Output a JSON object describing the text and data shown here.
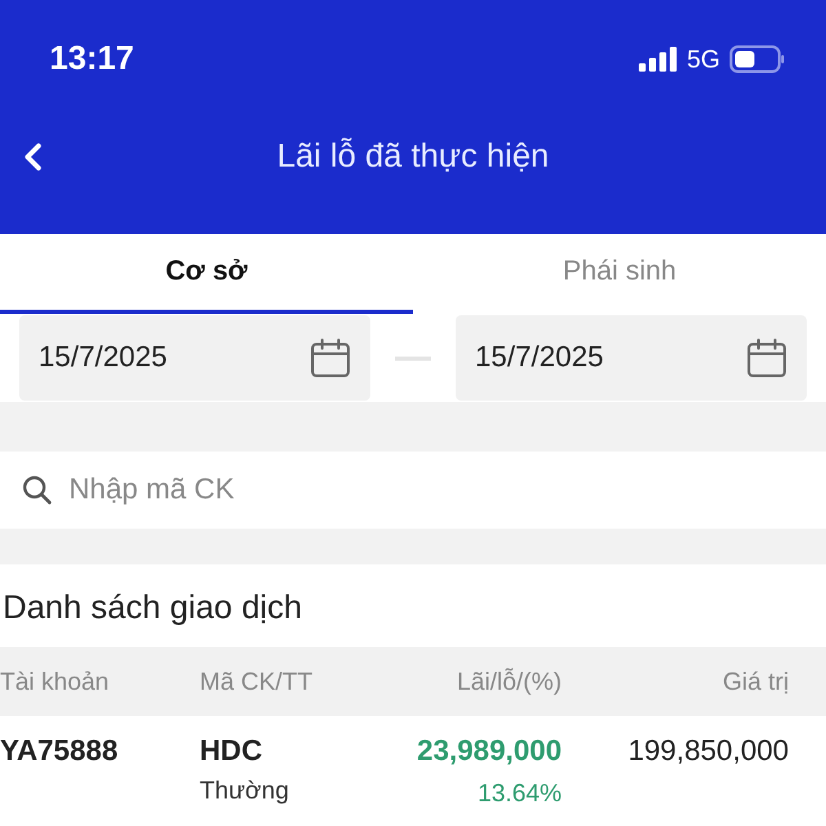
{
  "status_bar": {
    "time": "13:17",
    "network": "5G"
  },
  "header": {
    "title": "Lãi lỗ đã thực hiện"
  },
  "tabs": [
    {
      "label": "Cơ sở",
      "selected": true
    },
    {
      "label": "Phái sinh",
      "selected": false
    }
  ],
  "date_range": {
    "from": "15/7/2025",
    "to": "15/7/2025"
  },
  "search": {
    "placeholder": "Nhập mã CK"
  },
  "list": {
    "title": "Danh sách giao dịch",
    "columns": [
      "Tài khoản",
      "Mã CK/TT",
      "Lãi/lỗ/(%)",
      "Giá trị"
    ],
    "rows": [
      {
        "account": "YA75888",
        "symbol": "HDC",
        "type": "Thường",
        "pnl": "23,989,000",
        "pnl_percent": "13.64%",
        "color": "#2e9c6f",
        "value": "199,850,000"
      }
    ]
  }
}
